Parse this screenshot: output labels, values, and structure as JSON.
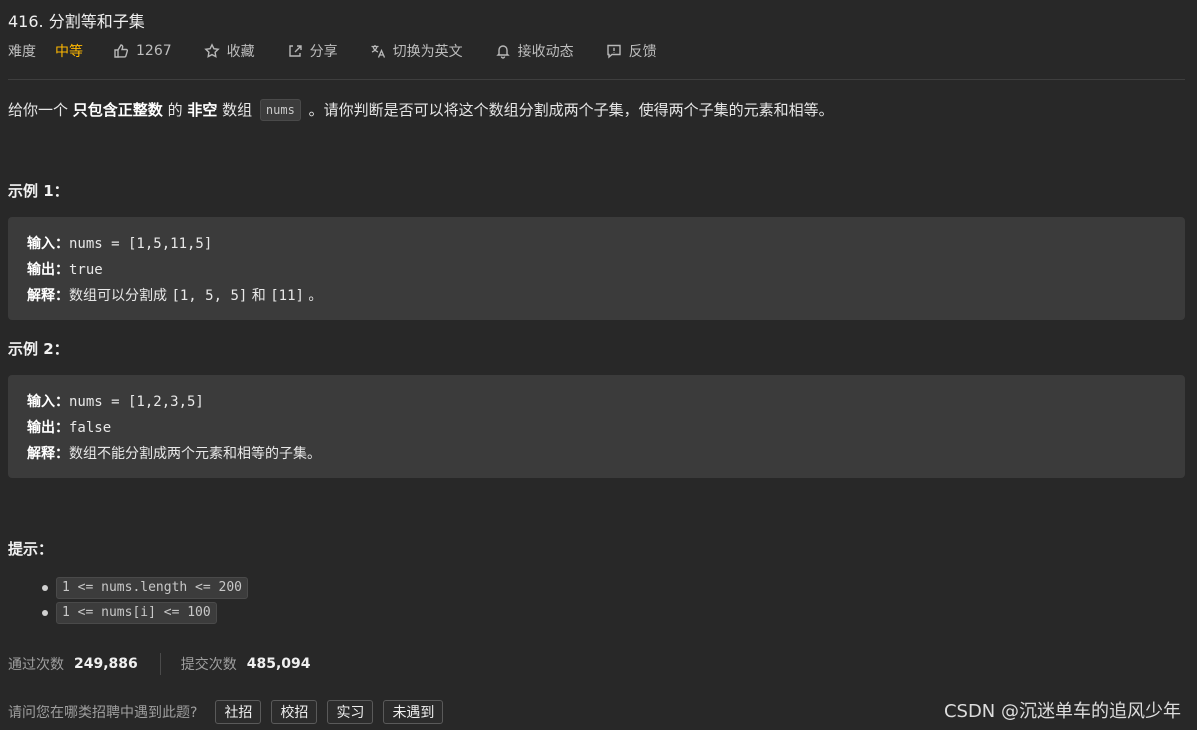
{
  "problem": {
    "title": "416. 分割等和子集",
    "difficulty_label": "难度",
    "difficulty": "中等",
    "likes": "1267",
    "actions": {
      "favorite": "收藏",
      "share": "分享",
      "translate": "切换为英文",
      "subscribe": "接收动态",
      "feedback": "反馈"
    }
  },
  "description": {
    "p1": "给你一个 ",
    "b1": "只包含正整数",
    "p2": " 的 ",
    "b2": "非空",
    "p3": " 数组 ",
    "code": "nums",
    "p4": " 。请你判断是否可以将这个数组分割成两个子集，使得两个子集的元素和相等。"
  },
  "examples": [
    {
      "title": "示例 1：",
      "input_label": "输入：",
      "input": "nums = [1,5,11,5]",
      "output_label": "输出：",
      "output": "true",
      "explain_label": "解释：",
      "explain_text": "数组可以分割成 ",
      "explain_code1": "[1, 5, 5]",
      "explain_mid": " 和 ",
      "explain_code2": "[11]",
      "explain_end": " 。"
    },
    {
      "title": "示例 2：",
      "input_label": "输入：",
      "input": "nums = [1,2,3,5]",
      "output_label": "输出：",
      "output": "false",
      "explain_label": "解释：",
      "explain_text": "数组不能分割成两个元素和相等的子集。"
    }
  ],
  "hints": {
    "title": "提示：",
    "items": [
      "1 <= nums.length <= 200",
      "1 <= nums[i] <= 100"
    ]
  },
  "stats": {
    "accepted_label": "通过次数",
    "accepted": "249,886",
    "submitted_label": "提交次数",
    "submitted": "485,094"
  },
  "interview": {
    "question": "请问您在哪类招聘中遇到此题?",
    "tags": [
      "社招",
      "校招",
      "实习",
      "未遇到"
    ]
  },
  "watermark": "CSDN @沉迷单车的追风少年"
}
